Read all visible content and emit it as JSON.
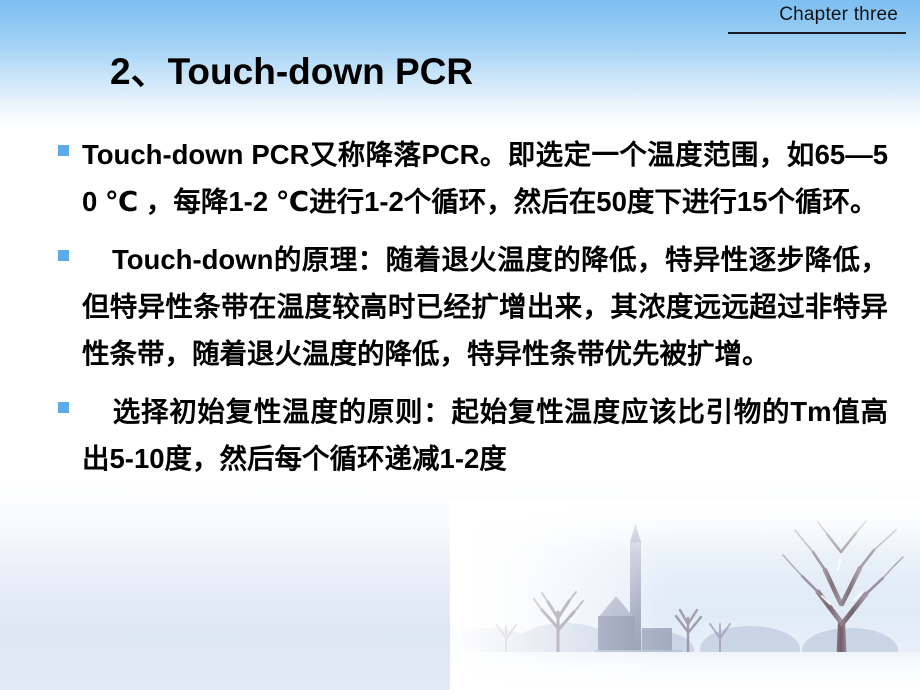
{
  "slide": {
    "header": {
      "chapter_label": "Chapter three"
    },
    "title": "2、Touch-down PCR",
    "bullets": [
      {
        "marker": "square-bullet",
        "text": "Touch-down PCR又称降落PCR。即选定一个温度范围，如65—50 ℃ ，每降1-2 ℃进行1-2个循环，然后在50度下进行15个循环。"
      },
      {
        "marker": "square-bullet",
        "text": "Touch-down的原理：随着退火温度的降低，特异性逐步降低，但特异性条带在温度较高时已经扩增出来，其浓度远远超过非特异性条带，随着退火温度的降低，特异性条带优先被扩增。"
      },
      {
        "marker": "square-bullet",
        "text": "选择初始复性温度的原则：起始复性温度应该比引物的Tm值高出5-10度，然后每个循环递减1-2度"
      }
    ],
    "colors": {
      "bullet_marker": "#5aabe8",
      "header_rule": "#16191d",
      "gradient_top": "#7dbff2",
      "text": "#000000"
    },
    "decoration": {
      "scene_name": "winter-landscape-church-and-bare-trees"
    }
  }
}
